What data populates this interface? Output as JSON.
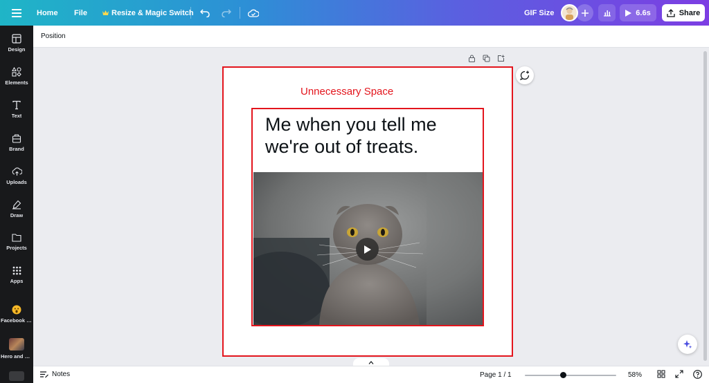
{
  "topbar": {
    "menu_icon": "hamburger-menu-icon",
    "home_label": "Home",
    "file_label": "File",
    "resize_label": "Resize & Magic Switch",
    "size_label": "GIF Size",
    "play_time": "6.6s",
    "share_label": "Share"
  },
  "sidebar": {
    "items": [
      {
        "label": "Design",
        "icon": "layout-icon"
      },
      {
        "label": "Elements",
        "icon": "shapes-icon"
      },
      {
        "label": "Text",
        "icon": "text-icon"
      },
      {
        "label": "Brand",
        "icon": "brand-icon"
      },
      {
        "label": "Uploads",
        "icon": "cloud-upload-icon"
      },
      {
        "label": "Draw",
        "icon": "pen-icon"
      },
      {
        "label": "Projects",
        "icon": "folder-icon"
      },
      {
        "label": "Apps",
        "icon": "apps-grid-icon"
      },
      {
        "label": "Facebook R...",
        "icon": "facebook-reactions-app-icon"
      },
      {
        "label": "Hero and Sk...",
        "icon": "hero-app-icon"
      }
    ]
  },
  "context_toolbar": {
    "position_label": "Position"
  },
  "canvas": {
    "annotation_text": "Unnecessary Space",
    "headline": "Me when you tell me we're out of treats.",
    "accent_color": "#e3141c"
  },
  "bottombar": {
    "notes_label": "Notes",
    "page_label": "Page 1 / 1",
    "zoom_label": "58%",
    "zoom_fraction": 0.58
  }
}
